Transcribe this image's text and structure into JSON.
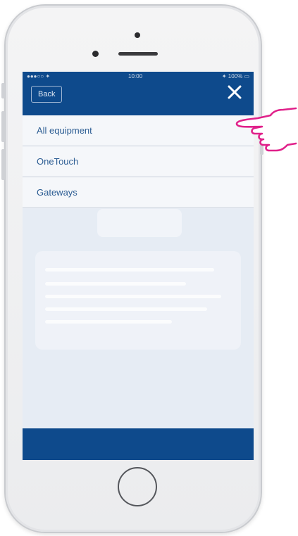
{
  "status_bar": {
    "carrier": "●●●○○ ✦",
    "time": "10:00",
    "battery": "✦ 100% ▭"
  },
  "nav": {
    "back_label": "Back",
    "close_icon": "close-icon"
  },
  "menu": {
    "items": [
      {
        "label": "All equipment"
      },
      {
        "label": "OneTouch"
      },
      {
        "label": "Gateways"
      }
    ]
  },
  "colors": {
    "brand_blue": "#0e4a8c",
    "menu_text": "#2c5d93",
    "hand_outline": "#e0218a"
  },
  "icons": {
    "pointer": "pointing-hand-icon",
    "home": "home-button"
  }
}
